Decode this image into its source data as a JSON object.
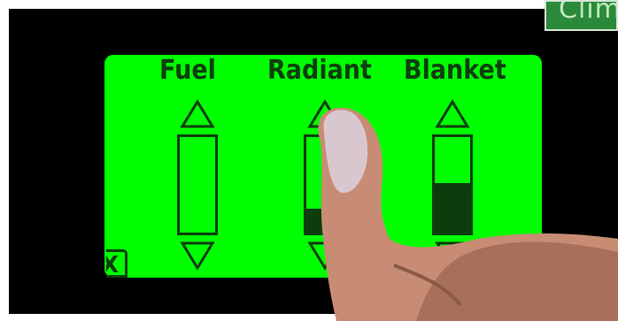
{
  "corner_button": {
    "label": "Clim"
  },
  "panel": {
    "back_label": "X",
    "columns": [
      {
        "label": "Fuel",
        "level": 0.0
      },
      {
        "label": "Radiant",
        "level": 0.25
      },
      {
        "label": "Blanket",
        "level": 0.52
      }
    ]
  },
  "colors": {
    "screen": "#000000",
    "panel": "#00ff00",
    "ink": "#0d3d0d",
    "corner_button": "#2a8a3a"
  },
  "icons": {
    "increase": "up-triangle-outline",
    "decrease": "down-triangle-outline"
  }
}
